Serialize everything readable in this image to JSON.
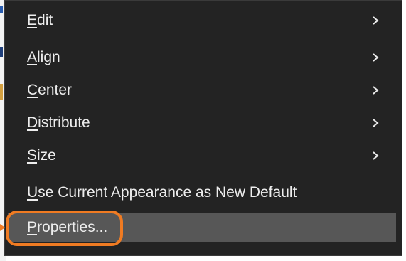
{
  "menu": {
    "items": [
      {
        "label": "Edit",
        "has_submenu": true
      },
      {
        "label": "Align",
        "has_submenu": true
      },
      {
        "label": "Center",
        "has_submenu": true
      },
      {
        "label": "Distribute",
        "has_submenu": true
      },
      {
        "label": "Size",
        "has_submenu": true
      },
      {
        "label": "Use Current Appearance as New Default",
        "has_submenu": false
      },
      {
        "label": "Properties...",
        "has_submenu": false,
        "highlighted": true
      }
    ]
  },
  "colors": {
    "menu_background": "#232323",
    "menu_text": "#ededed",
    "hover_background": "#575757",
    "highlight_annotation": "#f07b22"
  }
}
